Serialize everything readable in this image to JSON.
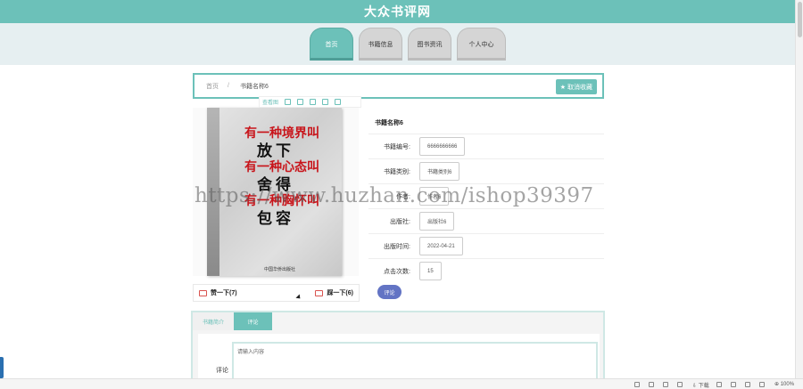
{
  "site": {
    "title": "大众书评网"
  },
  "nav": [
    {
      "label": "首页",
      "active": true
    },
    {
      "label": "书籍信息",
      "active": false
    },
    {
      "label": "图书资讯",
      "active": false
    },
    {
      "label": "个人中心",
      "active": false
    }
  ],
  "breadcrumb": {
    "home": "首页",
    "separator": "/",
    "current": "书籍名称6"
  },
  "collect_button": {
    "icon": "star-icon",
    "label": "取消收藏"
  },
  "image_toolbar": {
    "label": "查看图",
    "icons": [
      "zoom-icon",
      "file-icon",
      "expand-icon",
      "image-icon",
      "share-icon",
      "settings-icon"
    ]
  },
  "cover": {
    "lines": [
      "有一种境界叫",
      "放下",
      "有一种心态叫",
      "舍得",
      "有一种胸怀叫",
      "包容"
    ],
    "side_text": "有一种境界叫放下 有一种心态叫舍得 有一种胸怀叫包容",
    "publisher": "中国华侨出版社"
  },
  "votes": {
    "up_label": "赞一下(7)",
    "down_label": "踩一下(6)"
  },
  "book": {
    "name": "书籍名称6",
    "fields": [
      {
        "label": "书籍编号:",
        "value": "6666666666"
      },
      {
        "label": "书籍类别:",
        "value": "书籍类别6"
      },
      {
        "label": "作者:",
        "value": "作者6"
      },
      {
        "label": "出版社:",
        "value": "出版社6"
      },
      {
        "label": "出版时间:",
        "value": "2022-04-21"
      },
      {
        "label": "点击次数:",
        "value": "15"
      }
    ],
    "comment_button": "评论"
  },
  "tabs": {
    "intro": "书籍简介",
    "comment": "评论"
  },
  "comment_form": {
    "label": "评论",
    "placeholder": "请输入内容"
  },
  "watermark": "https://www.huzhan.com/ishop39397",
  "statusbar": {
    "download": "下载",
    "zoom": "100%"
  }
}
